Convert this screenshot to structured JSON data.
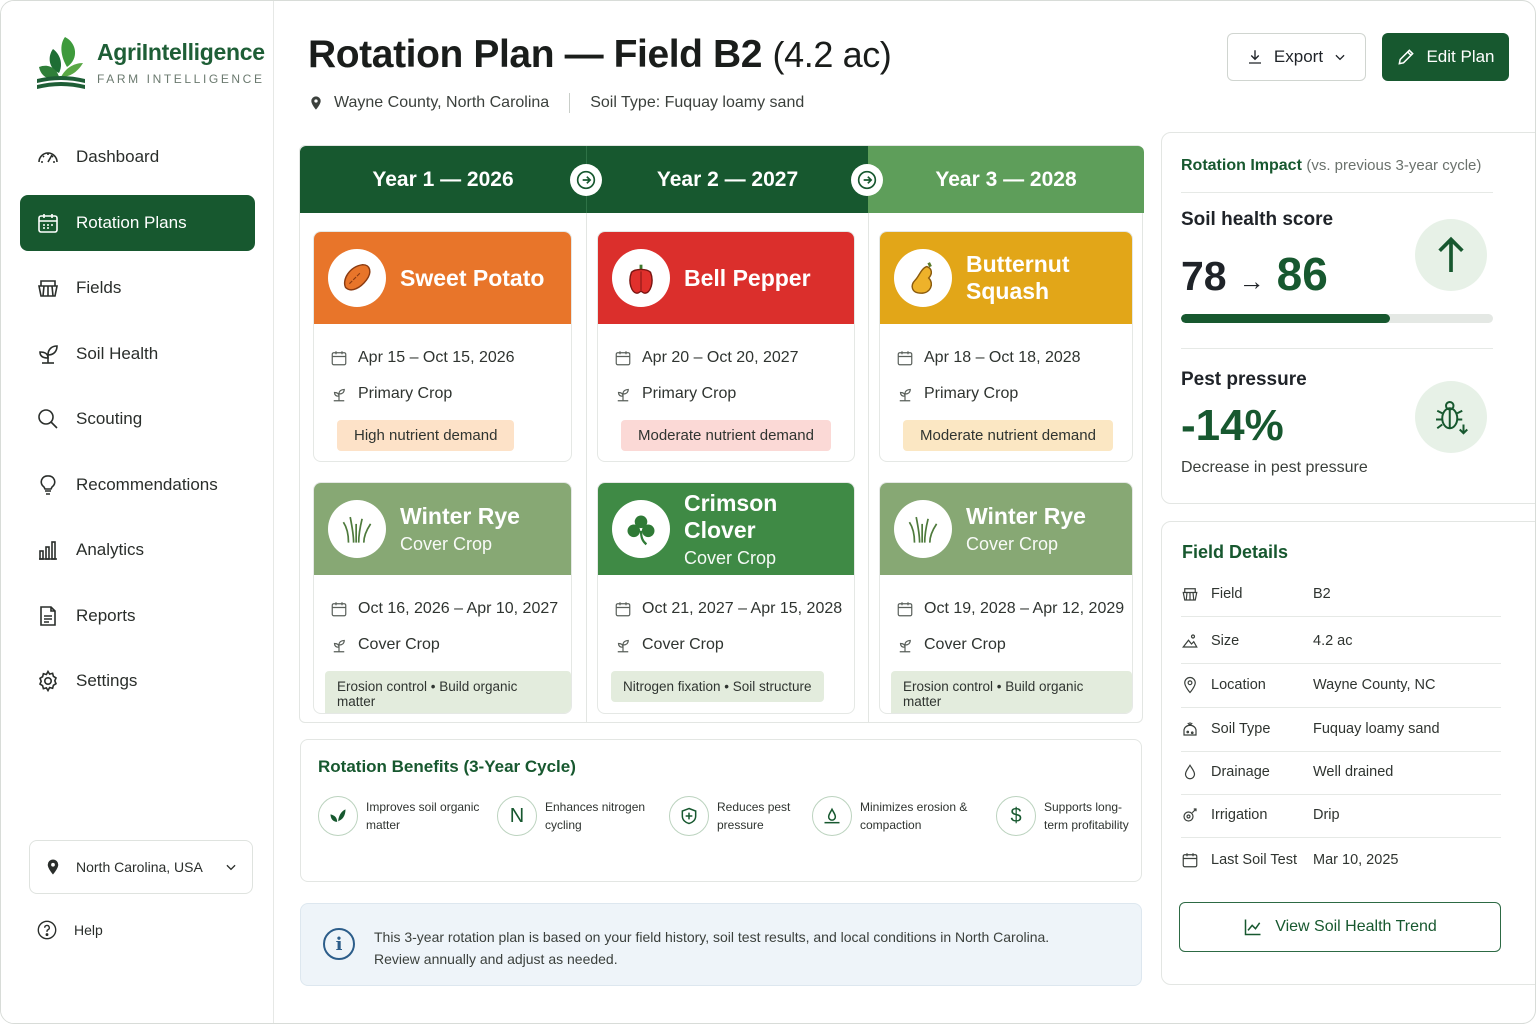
{
  "app": {
    "name": "AgriIntelligence",
    "tagline": "FARM INTELLIGENCE"
  },
  "sidebar": {
    "items": [
      {
        "label": "Dashboard",
        "icon": "gauge-icon"
      },
      {
        "label": "Rotation Plans",
        "icon": "calendar-icon",
        "active": true
      },
      {
        "label": "Fields",
        "icon": "fields-icon"
      },
      {
        "label": "Soil Health",
        "icon": "leaf-icon"
      },
      {
        "label": "Scouting",
        "icon": "search-icon"
      },
      {
        "label": "Recommendations",
        "icon": "lightbulb-icon"
      },
      {
        "label": "Analytics",
        "icon": "bar-chart-icon"
      },
      {
        "label": "Reports",
        "icon": "document-icon"
      },
      {
        "label": "Settings",
        "icon": "gear-icon"
      }
    ],
    "region": "North Carolina, USA",
    "help": "Help"
  },
  "header": {
    "title": "Rotation Plan — Field B2",
    "acreage": "(4.2 ac)",
    "location": "Wayne County, North Carolina",
    "soil": "Soil Type: Fuquay loamy sand",
    "export_label": "Export",
    "edit_label": "Edit Plan"
  },
  "plan": {
    "years": [
      "Year 1 — 2026",
      "Year 2 — 2027",
      "Year 3 — 2028"
    ],
    "primary": [
      {
        "name": "Sweet Potato",
        "dates": "Apr 15 – Oct 15, 2026",
        "role": "Primary Crop",
        "tag": "High nutrient demand",
        "color": "#e8752a",
        "tag_bg": "#fde2c8"
      },
      {
        "name": "Bell Pepper",
        "dates": "Apr 20 – Oct 20, 2027",
        "role": "Primary Crop",
        "tag": "Moderate nutrient demand",
        "color": "#db2f2c",
        "tag_bg": "#fbd9d6"
      },
      {
        "name": "Butternut Squash",
        "dates": "Apr 18 – Oct 18, 2028",
        "role": "Primary Crop",
        "tag": "Moderate nutrient demand",
        "color": "#e2a618",
        "tag_bg": "#fbe7c3"
      }
    ],
    "cover": [
      {
        "name": "Winter Rye",
        "sub": "Cover Crop",
        "dates": "Oct 16, 2026 – Apr 10, 2027",
        "role": "Cover Crop",
        "tag": "Erosion control • Build organic matter",
        "color": "#87a874",
        "tag_bg": "#e3ecdd"
      },
      {
        "name": "Crimson Clover",
        "sub": "Cover Crop",
        "dates": "Oct 21, 2027 – Apr 15, 2028",
        "role": "Cover Crop",
        "tag": "Nitrogen fixation • Soil structure",
        "color": "#3f8a45",
        "tag_bg": "#e3ecdd"
      },
      {
        "name": "Winter Rye",
        "sub": "Cover Crop",
        "dates": "Oct 19, 2028 – Apr 12, 2029",
        "role": "Cover Crop",
        "tag": "Erosion control • Build organic matter",
        "color": "#87a874",
        "tag_bg": "#e3ecdd"
      }
    ]
  },
  "benefits": {
    "title": "Rotation Benefits (3-Year Cycle)",
    "items": [
      {
        "text": "Improves soil organic matter",
        "icon": "leaf-icon"
      },
      {
        "text": "Enhances nitrogen cycling",
        "icon": "nitrogen-icon",
        "glyph": "N"
      },
      {
        "text": "Reduces pest pressure",
        "icon": "shield-icon"
      },
      {
        "text": "Minimizes erosion & compaction",
        "icon": "erosion-icon"
      },
      {
        "text": "Supports long-term profitability",
        "icon": "dollar-icon",
        "glyph": "$"
      }
    ]
  },
  "note": {
    "line1": "This 3-year rotation plan is based on your field history, soil test results, and local conditions in North Carolina.",
    "line2": "Review annually and adjust as needed."
  },
  "impact": {
    "title": "Rotation Impact",
    "subtitle": "(vs. previous 3-year cycle)",
    "soil_label": "Soil health score",
    "soil_old": "78",
    "soil_arrow": "→",
    "soil_new": "86",
    "soil_progress": 0.67,
    "pest_label": "Pest pressure",
    "pest_value": "-14%",
    "pest_desc": "Decrease in pest pressure"
  },
  "details": {
    "title": "Field Details",
    "rows": [
      {
        "key": "Field",
        "value": "B2",
        "icon": "fields-icon"
      },
      {
        "key": "Size",
        "value": "4.2 ac",
        "icon": "area-icon"
      },
      {
        "key": "Location",
        "value": "Wayne County, NC",
        "icon": "pin-icon"
      },
      {
        "key": "Soil Type",
        "value": "Fuquay loamy sand",
        "icon": "soil-icon"
      },
      {
        "key": "Drainage",
        "value": "Well drained",
        "icon": "drop-icon"
      },
      {
        "key": "Irrigation",
        "value": "Drip",
        "icon": "irrigation-icon"
      },
      {
        "key": "Last Soil Test",
        "value": "Mar 10, 2025",
        "icon": "calendar-icon"
      }
    ],
    "trend_button": "View Soil Health Trend"
  },
  "colors": {
    "brand": "#17582f",
    "accent": "#5e9e5a"
  }
}
